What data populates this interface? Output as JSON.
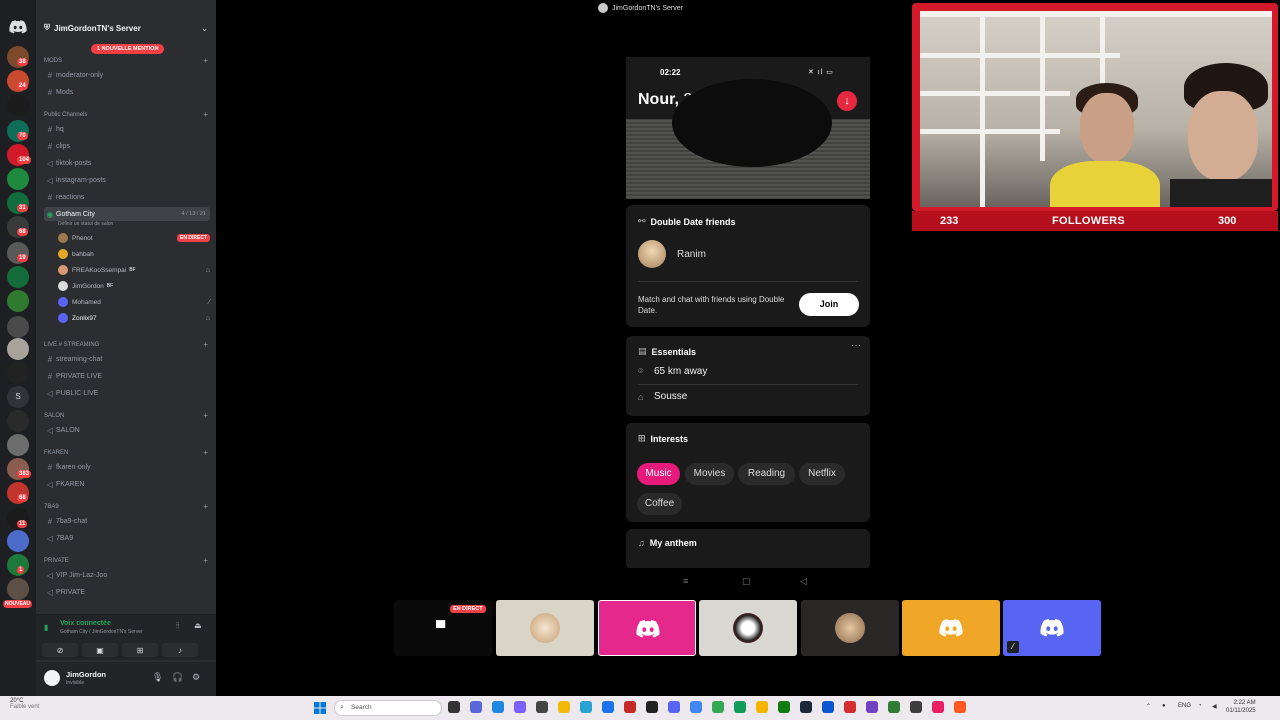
{
  "window": {
    "title": "JimGordonTN's Server"
  },
  "server": {
    "name": "JimGordonTN's Server",
    "mention_pill": "1 NOUVELLE MENTION",
    "nouveau_badge": "NOUVEAU"
  },
  "rail_badges": [
    "38",
    "24",
    "70",
    "104",
    "31",
    "68",
    "19",
    "383",
    "68",
    "11",
    "1",
    "1"
  ],
  "categories": {
    "mods": "MODS",
    "public": "Public Channels",
    "live": "LIVE # STREAMING",
    "salon": "SALON",
    "fkaren": "FKAREN",
    "tba9": "7BA9",
    "private": "PRIVATE"
  },
  "channels": {
    "moderator_only": "moderator-only",
    "mods": "Mods",
    "hq": "hq",
    "clips": "clips",
    "tiktok_posts": "tiktok-posts",
    "instagram_posts": "instagram-posts",
    "reactions": "reactions",
    "gotham_city": "Gotham City",
    "gotham_time": "4 / 13 / 21",
    "gotham_status": "Définir un statut de salon",
    "streaming_chat": "streaming-chat",
    "private_live": "PRIVATE LIVE",
    "public_live": "PUBLIC LIVE",
    "salon": "SALON",
    "fkaren_only": "fkaren-only",
    "fkaren": "FKAREN",
    "tba9_chat": "7ba9-chat",
    "tba9": "7BA9",
    "vip_jim": "VIP Jim-Laz-Joo",
    "private": "PRIVATE"
  },
  "voice_users": [
    {
      "name": "Phenot",
      "live": "EN DIRECT"
    },
    {
      "name": "bahbah"
    },
    {
      "name": "FREAKooSsempai",
      "tag": "BF"
    },
    {
      "name": "JimGordon",
      "tag": "BF"
    },
    {
      "name": "Mohamed"
    },
    {
      "name": "Zonlix97"
    }
  ],
  "voice_panel": {
    "title": "Voix connectée",
    "subtitle": "Gotham City / JimGordonTN's Server"
  },
  "user_panel": {
    "name": "JimGordon",
    "status": "Invisible"
  },
  "phone": {
    "time": "02:22",
    "name": "Nour,",
    "age": "25",
    "double_date": {
      "title": "Double Date friends",
      "friend": "Ranim",
      "description": "Match and chat with friends using Double Date.",
      "join": "Join"
    },
    "essentials": {
      "title": "Essentials",
      "distance": "65 km away",
      "city": "Sousse"
    },
    "interests": {
      "title": "Interests",
      "items": [
        "Music",
        "Movies",
        "Reading",
        "Netflix",
        "Coffee"
      ]
    },
    "anthem": {
      "title": "My anthem"
    }
  },
  "cam": {
    "left_count": "233",
    "label": "FOLLOWERS",
    "right_count": "300"
  },
  "tiles": {
    "live_badge": "EN DIRECT"
  },
  "taskbar": {
    "weather": "20°C",
    "weather_sub": "Faible vent",
    "search": "Search",
    "lang": "ENG",
    "time": "2:22 AM",
    "date": "01/11/2025"
  },
  "colors": {
    "accent_discord": "#5865f2",
    "live_red": "#ed4245",
    "tinder_pink": "#e51a7a",
    "cam_red": "#d41a2a"
  }
}
